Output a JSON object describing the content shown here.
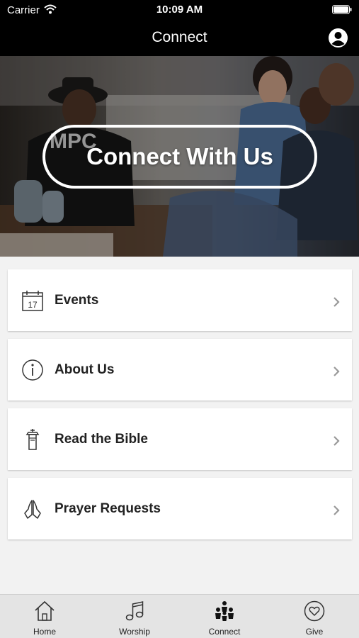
{
  "status_bar": {
    "carrier": "Carrier",
    "time": "10:09 AM"
  },
  "nav": {
    "title": "Connect",
    "profile_icon": "profile-icon"
  },
  "hero": {
    "button_label": "Connect With Us",
    "shirt_text": "MPC"
  },
  "menu": {
    "items": [
      {
        "label": "Events",
        "icon": "calendar-icon",
        "calendar_day": "17"
      },
      {
        "label": "About Us",
        "icon": "info-icon"
      },
      {
        "label": "Read the Bible",
        "icon": "bible-icon"
      },
      {
        "label": "Prayer Requests",
        "icon": "praying-hands-icon"
      }
    ]
  },
  "tabs": [
    {
      "label": "Home",
      "icon": "home-icon",
      "active": false
    },
    {
      "label": "Worship",
      "icon": "music-note-icon",
      "active": false
    },
    {
      "label": "Connect",
      "icon": "people-icon",
      "active": true
    },
    {
      "label": "Give",
      "icon": "heart-icon",
      "active": false
    }
  ],
  "colors": {
    "bar_background": "#000000",
    "tab_bar_background": "#e4e4e4",
    "page_background": "#f2f2f2"
  }
}
